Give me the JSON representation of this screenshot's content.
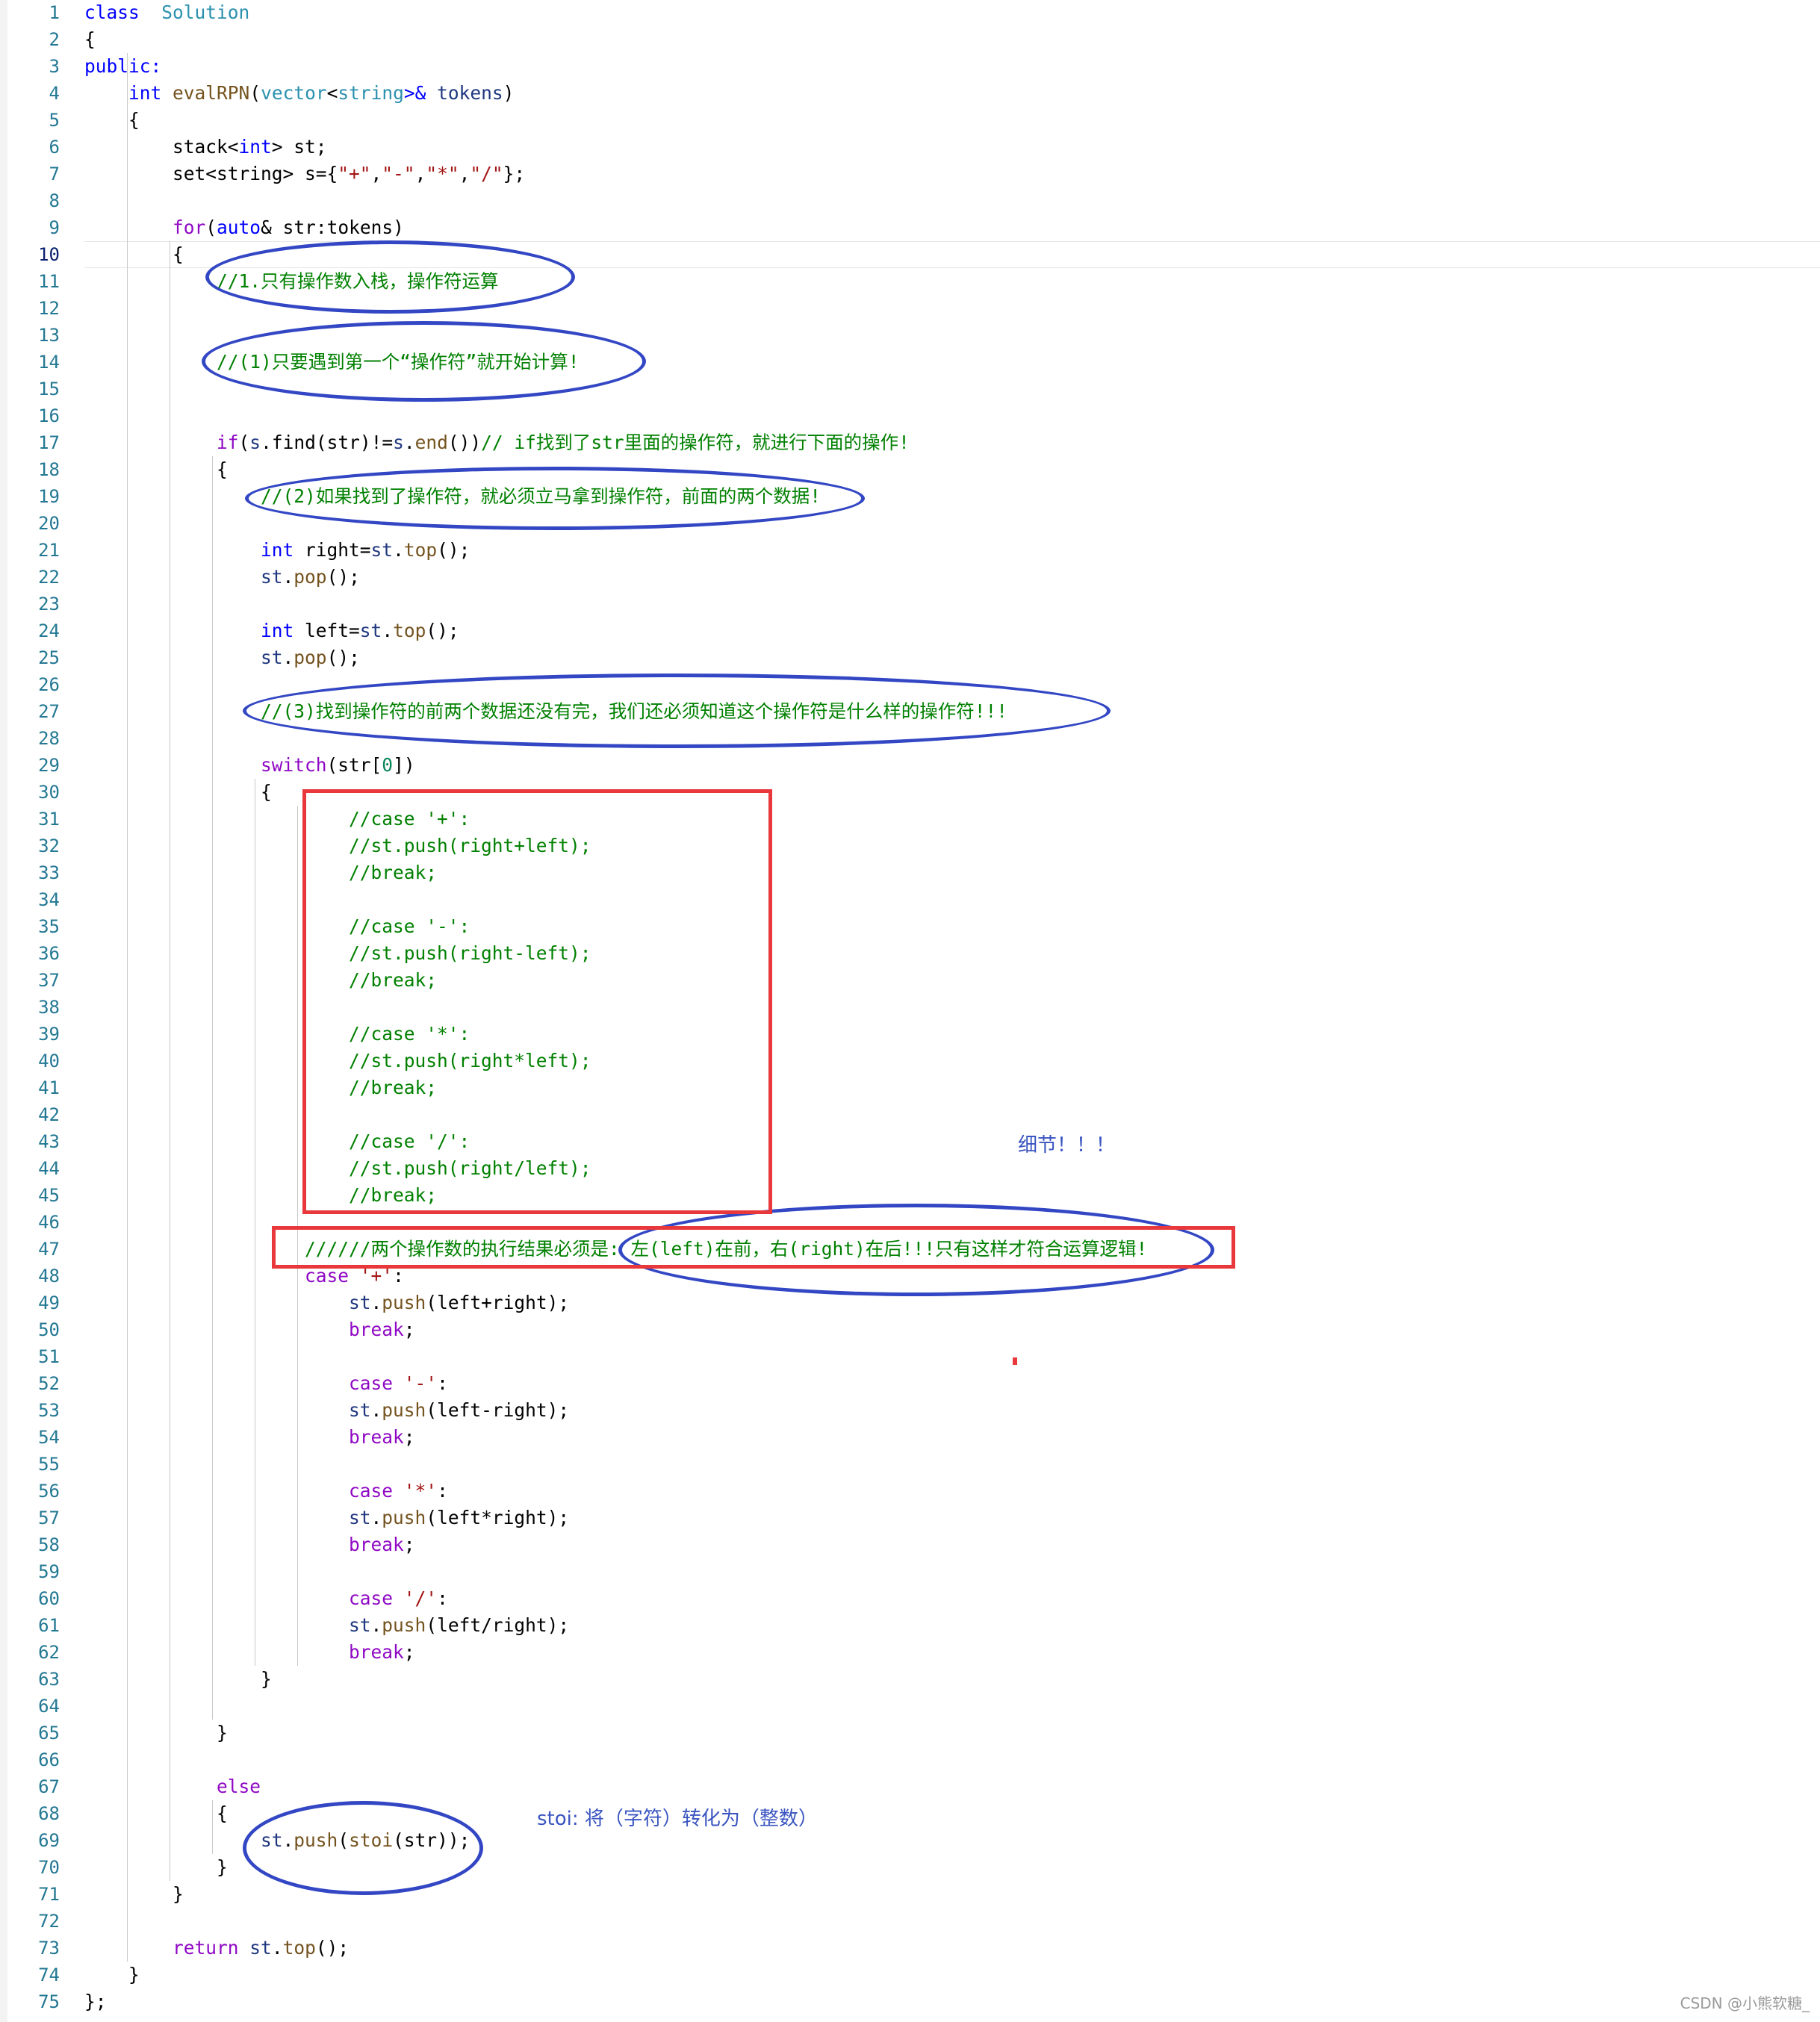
{
  "editor": {
    "line_numbers": [
      "1",
      "2",
      "3",
      "4",
      "5",
      "6",
      "7",
      "8",
      "9",
      "10",
      "11",
      "12",
      "13",
      "14",
      "15",
      "16",
      "17",
      "18",
      "19",
      "20",
      "21",
      "22",
      "23",
      "24",
      "25",
      "26",
      "27",
      "28",
      "29",
      "30",
      "31",
      "32",
      "33",
      "34",
      "35",
      "36",
      "37",
      "38",
      "39",
      "40",
      "41",
      "42",
      "43",
      "44",
      "45",
      "46",
      "47",
      "48",
      "49",
      "50",
      "51",
      "52",
      "53",
      "54",
      "55",
      "56",
      "57",
      "58",
      "59",
      "60",
      "61",
      "62",
      "63",
      "64",
      "65",
      "66",
      "67",
      "68",
      "69",
      "70",
      "71",
      "72",
      "73",
      "74",
      "75"
    ],
    "active_line": "10",
    "lines": [
      [
        [
          "kw",
          "class"
        ],
        [
          "",
          "  "
        ],
        [
          "ty",
          "Solution"
        ]
      ],
      [
        [
          "",
          "{"
        ]
      ],
      [
        [
          "kw",
          "public:"
        ]
      ],
      [
        [
          "",
          "    "
        ],
        [
          "kw",
          "int"
        ],
        [
          "",
          " "
        ],
        [
          "fn",
          "evalRPN"
        ],
        [
          "",
          "("
        ],
        [
          "ty",
          "vector"
        ],
        [
          "",
          "<"
        ],
        [
          "ty",
          "string"
        ],
        [
          "kw",
          ">&"
        ],
        [
          "",
          " "
        ],
        [
          "var",
          "tokens"
        ],
        [
          "",
          ")"
        ]
      ],
      [
        [
          "",
          "    {"
        ]
      ],
      [
        [
          "",
          "        stack<"
        ],
        [
          "kw",
          "int"
        ],
        [
          "",
          "> st;"
        ]
      ],
      [
        [
          "",
          "        set<string> s={"
        ],
        [
          "str",
          "\"+\""
        ],
        [
          "",
          ","
        ],
        [
          "str",
          "\"-\""
        ],
        [
          "",
          ","
        ],
        [
          "str",
          "\"*\""
        ],
        [
          "",
          ","
        ],
        [
          "str",
          "\"/\""
        ],
        [
          "",
          "};"
        ]
      ],
      [
        [
          "",
          ""
        ]
      ],
      [
        [
          "",
          "        "
        ],
        [
          "kw2",
          "for"
        ],
        [
          "",
          "("
        ],
        [
          "kw",
          "auto"
        ],
        [
          "",
          "& str:tokens)"
        ]
      ],
      [
        [
          "",
          "        {"
        ]
      ],
      [
        [
          "",
          "            "
        ],
        [
          "cm",
          "//1.只有操作数入栈，操作符运算"
        ]
      ],
      [
        [
          "",
          ""
        ]
      ],
      [
        [
          "",
          ""
        ]
      ],
      [
        [
          "",
          "            "
        ],
        [
          "cm",
          "//(1)只要遇到第一个“操作符”就开始计算!"
        ]
      ],
      [
        [
          "",
          ""
        ]
      ],
      [
        [
          "",
          ""
        ]
      ],
      [
        [
          "",
          "            "
        ],
        [
          "kw2",
          "if"
        ],
        [
          "",
          "("
        ],
        [
          "var",
          "s"
        ],
        [
          "",
          ".find(str)!="
        ],
        [
          "var",
          "s"
        ],
        [
          "",
          "."
        ],
        [
          "fn",
          "end"
        ],
        [
          "",
          "())"
        ],
        [
          "cm",
          "// if找到了str里面的操作符，就进行下面的操作!"
        ]
      ],
      [
        [
          "",
          "            {"
        ]
      ],
      [
        [
          "",
          "                "
        ],
        [
          "cm",
          "//(2)如果找到了操作符，就必须立马拿到操作符，前面的两个数据!"
        ]
      ],
      [
        [
          "",
          ""
        ]
      ],
      [
        [
          "",
          "                "
        ],
        [
          "kw",
          "int"
        ],
        [
          "",
          " right="
        ],
        [
          "var",
          "st"
        ],
        [
          "",
          "."
        ],
        [
          "fn",
          "top"
        ],
        [
          "",
          "();"
        ]
      ],
      [
        [
          "",
          "                "
        ],
        [
          "var",
          "st"
        ],
        [
          "",
          "."
        ],
        [
          "fn",
          "pop"
        ],
        [
          "",
          "();"
        ]
      ],
      [
        [
          "",
          ""
        ]
      ],
      [
        [
          "",
          "                "
        ],
        [
          "kw",
          "int"
        ],
        [
          "",
          " left="
        ],
        [
          "var",
          "st"
        ],
        [
          "",
          "."
        ],
        [
          "fn",
          "top"
        ],
        [
          "",
          "();"
        ]
      ],
      [
        [
          "",
          "                "
        ],
        [
          "var",
          "st"
        ],
        [
          "",
          "."
        ],
        [
          "fn",
          "pop"
        ],
        [
          "",
          "();"
        ]
      ],
      [
        [
          "",
          ""
        ]
      ],
      [
        [
          "",
          "                "
        ],
        [
          "cm",
          "//(3)找到操作符的前两个数据还没有完，我们还必须知道这个操作符是什么样的操作符!!!"
        ]
      ],
      [
        [
          "",
          ""
        ]
      ],
      [
        [
          "",
          "                "
        ],
        [
          "kw2",
          "switch"
        ],
        [
          "",
          "(str["
        ],
        [
          "num",
          "0"
        ],
        [
          "",
          "])"
        ]
      ],
      [
        [
          "",
          "                {"
        ]
      ],
      [
        [
          "",
          "                        "
        ],
        [
          "cm",
          "//case '+':"
        ]
      ],
      [
        [
          "",
          "                        "
        ],
        [
          "cm",
          "//st.push(right+left);"
        ]
      ],
      [
        [
          "",
          "                        "
        ],
        [
          "cm",
          "//break;"
        ]
      ],
      [
        [
          "",
          ""
        ]
      ],
      [
        [
          "",
          "                        "
        ],
        [
          "cm",
          "//case '-':"
        ]
      ],
      [
        [
          "",
          "                        "
        ],
        [
          "cm",
          "//st.push(right-left);"
        ]
      ],
      [
        [
          "",
          "                        "
        ],
        [
          "cm",
          "//break;"
        ]
      ],
      [
        [
          "",
          ""
        ]
      ],
      [
        [
          "",
          "                        "
        ],
        [
          "cm",
          "//case '*':"
        ]
      ],
      [
        [
          "",
          "                        "
        ],
        [
          "cm",
          "//st.push(right*left);"
        ]
      ],
      [
        [
          "",
          "                        "
        ],
        [
          "cm",
          "//break;"
        ]
      ],
      [
        [
          "",
          ""
        ]
      ],
      [
        [
          "",
          "                        "
        ],
        [
          "cm",
          "//case '/':"
        ]
      ],
      [
        [
          "",
          "                        "
        ],
        [
          "cm",
          "//st.push(right/left);"
        ]
      ],
      [
        [
          "",
          "                        "
        ],
        [
          "cm",
          "//break;"
        ]
      ],
      [
        [
          "",
          ""
        ]
      ],
      [
        [
          "",
          "                    "
        ],
        [
          "cm",
          "//////两个操作数的执行结果必须是: 左(left)在前，右(right)在后!!!只有这样才符合运算逻辑!"
        ]
      ],
      [
        [
          "",
          "                    "
        ],
        [
          "kw2",
          "case"
        ],
        [
          "",
          " "
        ],
        [
          "str",
          "'+'"
        ],
        [
          "",
          ":"
        ]
      ],
      [
        [
          "",
          "                        "
        ],
        [
          "var",
          "st"
        ],
        [
          "",
          "."
        ],
        [
          "fn",
          "push"
        ],
        [
          "",
          "(left+right);"
        ]
      ],
      [
        [
          "",
          "                        "
        ],
        [
          "kw2",
          "break"
        ],
        [
          "",
          ";"
        ]
      ],
      [
        [
          "",
          ""
        ]
      ],
      [
        [
          "",
          "                        "
        ],
        [
          "kw2",
          "case"
        ],
        [
          "",
          " "
        ],
        [
          "str",
          "'-'"
        ],
        [
          "",
          ":"
        ]
      ],
      [
        [
          "",
          "                        "
        ],
        [
          "var",
          "st"
        ],
        [
          "",
          "."
        ],
        [
          "fn",
          "push"
        ],
        [
          "",
          "(left-right);"
        ]
      ],
      [
        [
          "",
          "                        "
        ],
        [
          "kw2",
          "break"
        ],
        [
          "",
          ";"
        ]
      ],
      [
        [
          "",
          ""
        ]
      ],
      [
        [
          "",
          "                        "
        ],
        [
          "kw2",
          "case"
        ],
        [
          "",
          " "
        ],
        [
          "str",
          "'*'"
        ],
        [
          "",
          ":"
        ]
      ],
      [
        [
          "",
          "                        "
        ],
        [
          "var",
          "st"
        ],
        [
          "",
          "."
        ],
        [
          "fn",
          "push"
        ],
        [
          "",
          "(left*right);"
        ]
      ],
      [
        [
          "",
          "                        "
        ],
        [
          "kw2",
          "break"
        ],
        [
          "",
          ";"
        ]
      ],
      [
        [
          "",
          ""
        ]
      ],
      [
        [
          "",
          "                        "
        ],
        [
          "kw2",
          "case"
        ],
        [
          "",
          " "
        ],
        [
          "str",
          "'/'"
        ],
        [
          "",
          ":"
        ]
      ],
      [
        [
          "",
          "                        "
        ],
        [
          "var",
          "st"
        ],
        [
          "",
          "."
        ],
        [
          "fn",
          "push"
        ],
        [
          "",
          "(left/right);"
        ]
      ],
      [
        [
          "",
          "                        "
        ],
        [
          "kw2",
          "break"
        ],
        [
          "",
          ";"
        ]
      ],
      [
        [
          "",
          "                }"
        ]
      ],
      [
        [
          "",
          ""
        ]
      ],
      [
        [
          "",
          "            }"
        ]
      ],
      [
        [
          "",
          ""
        ]
      ],
      [
        [
          "",
          "            "
        ],
        [
          "kw2",
          "else"
        ]
      ],
      [
        [
          "",
          "            {"
        ]
      ],
      [
        [
          "",
          "                "
        ],
        [
          "var",
          "st"
        ],
        [
          "",
          "."
        ],
        [
          "fn",
          "push"
        ],
        [
          "",
          "("
        ],
        [
          "fn",
          "stoi"
        ],
        [
          "",
          "(str));"
        ]
      ],
      [
        [
          "",
          "            }"
        ]
      ],
      [
        [
          "",
          "        }"
        ]
      ],
      [
        [
          "",
          ""
        ]
      ],
      [
        [
          "",
          "        "
        ],
        [
          "kw2",
          "return"
        ],
        [
          "",
          " "
        ],
        [
          "var",
          "st"
        ],
        [
          "",
          "."
        ],
        [
          "fn",
          "top"
        ],
        [
          "",
          "();"
        ]
      ],
      [
        [
          "",
          "    }"
        ]
      ],
      [
        [
          "",
          "};"
        ]
      ]
    ]
  },
  "annotations": {
    "note_detail": "细节！！！",
    "note_stoi": "stoi: 将（字符）转化为（整数）"
  },
  "watermark": "CSDN @小熊软糖_",
  "colors": {
    "keyword": "#0000ff",
    "control": "#8f08c4",
    "type": "#2b91af",
    "comment": "#008000",
    "ellipse": "#3347c4",
    "box": "#e8383b"
  }
}
